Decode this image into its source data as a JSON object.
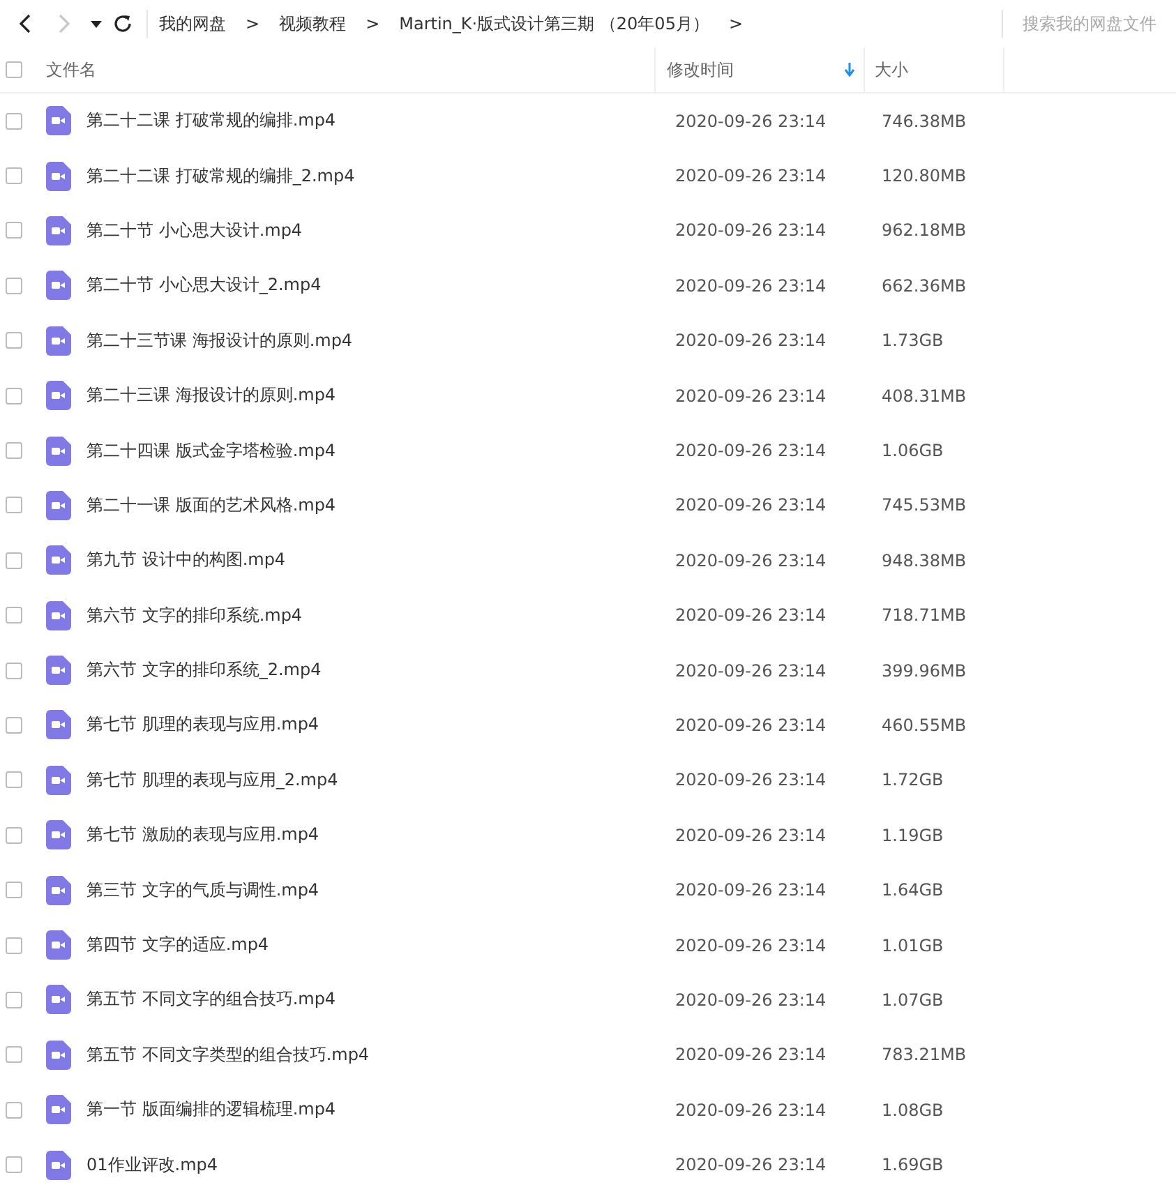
{
  "nav": {
    "back_disabled": false,
    "forward_disabled": true
  },
  "breadcrumb": [
    "我的网盘",
    "视频教程",
    "Martin_K·版式设计第三期 （20年05月）"
  ],
  "breadcrumb_separator": ">",
  "search": {
    "placeholder": "搜索我的网盘文件"
  },
  "table": {
    "columns": [
      {
        "label": "文件名",
        "sorted": false
      },
      {
        "label": "修改时间",
        "sorted": true
      },
      {
        "label": "大小",
        "sorted": false
      }
    ],
    "header_checked": false,
    "rows": [
      {
        "name": "第二十二课 打破常规的编排.mp4",
        "modified": "2020-09-26 23:14",
        "size": "746.38MB",
        "checked": false
      },
      {
        "name": "第二十二课 打破常规的编排_2.mp4",
        "modified": "2020-09-26 23:14",
        "size": "120.80MB",
        "checked": false
      },
      {
        "name": "第二十节 小心思大设计.mp4",
        "modified": "2020-09-26 23:14",
        "size": "962.18MB",
        "checked": false
      },
      {
        "name": "第二十节 小心思大设计_2.mp4",
        "modified": "2020-09-26 23:14",
        "size": "662.36MB",
        "checked": false
      },
      {
        "name": "第二十三节课 海报设计的原则.mp4",
        "modified": "2020-09-26 23:14",
        "size": "1.73GB",
        "checked": false
      },
      {
        "name": "第二十三课 海报设计的原则.mp4",
        "modified": "2020-09-26 23:14",
        "size": "408.31MB",
        "checked": false
      },
      {
        "name": "第二十四课 版式金字塔检验.mp4",
        "modified": "2020-09-26 23:14",
        "size": "1.06GB",
        "checked": false
      },
      {
        "name": "第二十一课 版面的艺术风格.mp4",
        "modified": "2020-09-26 23:14",
        "size": "745.53MB",
        "checked": false
      },
      {
        "name": "第九节 设计中的构图.mp4",
        "modified": "2020-09-26 23:14",
        "size": "948.38MB",
        "checked": false
      },
      {
        "name": "第六节 文字的排印系统.mp4",
        "modified": "2020-09-26 23:14",
        "size": "718.71MB",
        "checked": false
      },
      {
        "name": "第六节 文字的排印系统_2.mp4",
        "modified": "2020-09-26 23:14",
        "size": "399.96MB",
        "checked": false
      },
      {
        "name": "第七节 肌理的表现与应用.mp4",
        "modified": "2020-09-26 23:14",
        "size": "460.55MB",
        "checked": false
      },
      {
        "name": "第七节 肌理的表现与应用_2.mp4",
        "modified": "2020-09-26 23:14",
        "size": "1.72GB",
        "checked": false
      },
      {
        "name": "第七节 激励的表现与应用.mp4",
        "modified": "2020-09-26 23:14",
        "size": "1.19GB",
        "checked": false
      },
      {
        "name": "第三节 文字的气质与调性.mp4",
        "modified": "2020-09-26 23:14",
        "size": "1.64GB",
        "checked": false
      },
      {
        "name": "第四节 文字的适应.mp4",
        "modified": "2020-09-26 23:14",
        "size": "1.01GB",
        "checked": false
      },
      {
        "name": "第五节 不同文字的组合技巧.mp4",
        "modified": "2020-09-26 23:14",
        "size": "1.07GB",
        "checked": false
      },
      {
        "name": "第五节 不同文字类型的组合技巧.mp4",
        "modified": "2020-09-26 23:14",
        "size": "783.21MB",
        "checked": false
      },
      {
        "name": "第一节 版面编排的逻辑梳理.mp4",
        "modified": "2020-09-26 23:14",
        "size": "1.08GB",
        "checked": false
      },
      {
        "name": "01作业评改.mp4",
        "modified": "2020-09-26 23:14",
        "size": "1.69GB",
        "checked": false
      }
    ]
  }
}
